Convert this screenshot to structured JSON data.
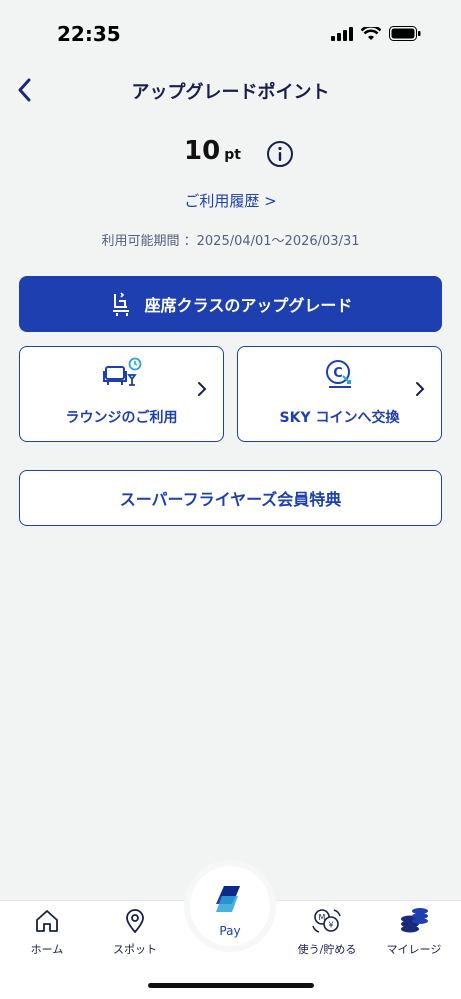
{
  "status": {
    "time": "22:35"
  },
  "header": {
    "title": "アップグレードポイント"
  },
  "points": {
    "value": "10",
    "unit": "pt"
  },
  "history_link": "ご利用履歴 >",
  "period": "利用可能期間 ：2025/04/01～2026/03/31",
  "primary_button": "座席クラスのアップグレード",
  "cards": [
    {
      "label": "ラウンジのご利用",
      "icon": "lounge-icon"
    },
    {
      "label": "SKY コインへ交換",
      "icon": "sky-coin-icon"
    }
  ],
  "wide_button": "スーパーフライヤーズ会員特典",
  "tabbar": {
    "items": [
      {
        "label": "ホーム",
        "icon": "home-icon"
      },
      {
        "label": "スポット",
        "icon": "location-pin-icon"
      },
      {
        "label": "Pay",
        "icon": "pay-logo-icon"
      },
      {
        "label": "使う/貯める",
        "icon": "exchange-icon"
      },
      {
        "label": "マイレージ",
        "icon": "mileage-coins-icon"
      }
    ]
  },
  "colors": {
    "primary": "#1d3fb0",
    "background": "#f2f3f3",
    "text_dark": "#1a1f4a"
  }
}
